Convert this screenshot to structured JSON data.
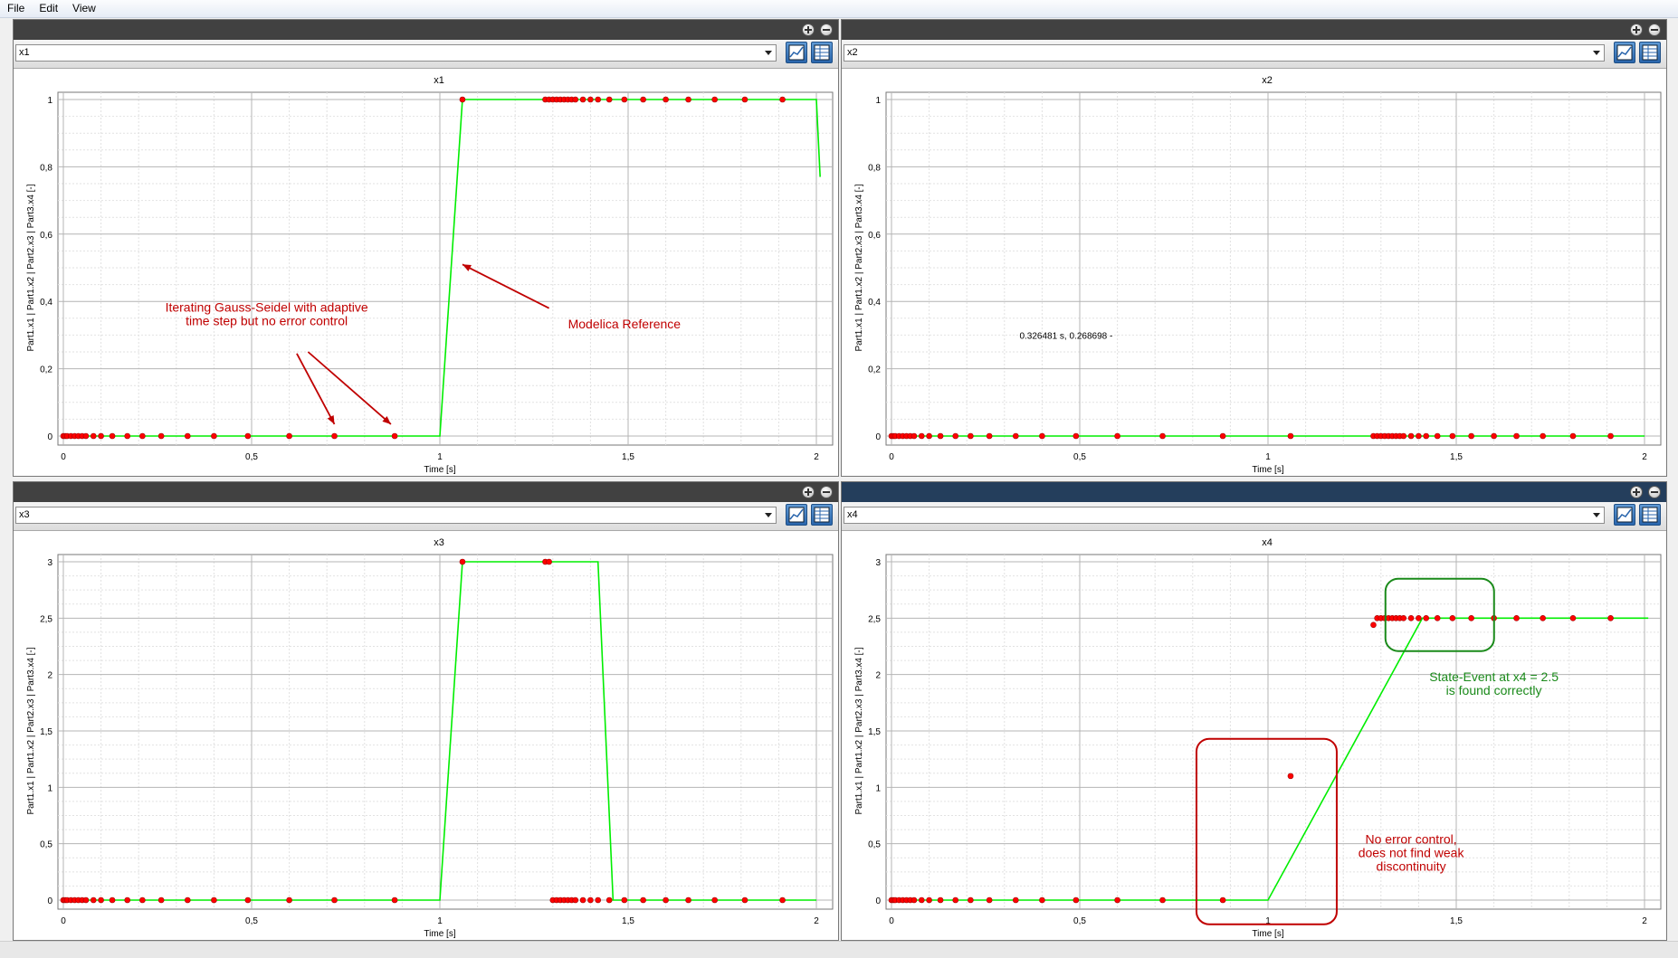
{
  "menu": [
    "File",
    "Edit",
    "View"
  ],
  "panels": [
    {
      "selector_value": "x1",
      "title": "x1",
      "ylabel": "Part1.x1 | Part1.x2 | Part2.x3 | Part3.x4 [-]",
      "xlabel": "Time [s]",
      "xticks": [
        "0",
        "0,5",
        "1",
        "1,5",
        "2"
      ],
      "yticks": [
        "0",
        "0,2",
        "0,4",
        "0,6",
        "0,8",
        "1"
      ],
      "annotations": [
        {
          "lines": [
            "Iterating Gauss-Seidel with adaptive",
            "time step but no error control"
          ],
          "color": "#c00000"
        },
        {
          "lines": [
            "Modelica Reference"
          ],
          "color": "#c00000"
        }
      ]
    },
    {
      "selector_value": "x2",
      "title": "x2",
      "ylabel": "Part1.x1 | Part1.x2 | Part2.x3 | Part3.x4 [-]",
      "xlabel": "Time [s]",
      "xticks": [
        "0",
        "0,5",
        "1",
        "1,5",
        "2"
      ],
      "yticks": [
        "0",
        "0,2",
        "0,4",
        "0,6",
        "0,8",
        "1"
      ],
      "cursor_readout": "0.326481 s, 0.268698 -"
    },
    {
      "selector_value": "x3",
      "title": "x3",
      "ylabel": "Part1.x1 | Part1.x2 | Part2.x3 | Part3.x4 [-]",
      "xlabel": "Time [s]",
      "xticks": [
        "0",
        "0,5",
        "1",
        "1,5",
        "2"
      ],
      "yticks": [
        "0",
        "0,5",
        "1",
        "1,5",
        "2",
        "2,5",
        "3"
      ]
    },
    {
      "selector_value": "x4",
      "title": "x4",
      "ylabel": "Part1.x1 | Part1.x2 | Part2.x3 | Part3.x4 [-]",
      "xlabel": "Time [s]",
      "xticks": [
        "0",
        "0,5",
        "1",
        "1,5",
        "2"
      ],
      "yticks": [
        "0",
        "0,5",
        "1",
        "1,5",
        "2",
        "2,5",
        "3"
      ],
      "annotations": [
        {
          "lines": [
            "State-Event at x4 = 2.5",
            "is found correctly"
          ],
          "color": "#1a8a1a"
        },
        {
          "lines": [
            "No error control,",
            "does not find weak",
            "discontinuity"
          ],
          "color": "#c00000"
        }
      ]
    }
  ],
  "colors": {
    "reference_line": "#00ee00",
    "samples": "#ff0000",
    "grid_major": "#b4b4b4",
    "grid_minor": "#e2e2e2"
  },
  "chart_data": [
    {
      "type": "line",
      "title": "x1",
      "xlabel": "Time [s]",
      "ylabel": "Part1.x1 | Part1.x2 | Part2.x3 | Part3.x4 [-]",
      "xlim": [
        0,
        2
      ],
      "ylim": [
        0,
        1
      ],
      "grid": true,
      "series": [
        {
          "x": [
            0,
            1.0,
            1.06,
            1.3,
            2.0,
            2.01
          ],
          "y": [
            0,
            0,
            1,
            1,
            1,
            0.77
          ]
        },
        {
          "x": [
            0.0,
            0.005,
            0.01,
            0.02,
            0.03,
            0.04,
            0.05,
            0.06,
            0.08,
            0.1,
            0.13,
            0.17,
            0.21,
            0.26,
            0.33,
            0.4,
            0.49,
            0.6,
            0.72,
            0.88,
            1.06,
            1.28,
            1.29,
            1.3,
            1.31,
            1.32,
            1.33,
            1.34,
            1.35,
            1.36,
            1.38,
            1.4,
            1.42,
            1.45,
            1.49,
            1.54,
            1.6,
            1.66,
            1.73,
            1.81,
            1.91
          ],
          "y": [
            0,
            0,
            0,
            0,
            0,
            0,
            0,
            0,
            0,
            0,
            0,
            0,
            0,
            0,
            0,
            0,
            0,
            0,
            0,
            0,
            1,
            1,
            1,
            1,
            1,
            1,
            1,
            1,
            1,
            1,
            1,
            1,
            1,
            1,
            1,
            1,
            1,
            1,
            1,
            1,
            1
          ]
        }
      ]
    },
    {
      "type": "line",
      "title": "x2",
      "xlabel": "Time [s]",
      "ylabel": "Part1.x1 | Part1.x2 | Part2.x3 | Part3.x4 [-]",
      "xlim": [
        0,
        2
      ],
      "ylim": [
        0,
        1
      ],
      "grid": true,
      "series": [
        {
          "x": [
            0,
            2.0
          ],
          "y": [
            0,
            0
          ]
        },
        {
          "x": [
            0.0,
            0.005,
            0.01,
            0.02,
            0.03,
            0.04,
            0.05,
            0.06,
            0.08,
            0.1,
            0.13,
            0.17,
            0.21,
            0.26,
            0.33,
            0.4,
            0.49,
            0.6,
            0.72,
            0.88,
            1.06,
            1.28,
            1.29,
            1.3,
            1.31,
            1.32,
            1.33,
            1.34,
            1.35,
            1.36,
            1.38,
            1.4,
            1.42,
            1.45,
            1.49,
            1.54,
            1.6,
            1.66,
            1.73,
            1.81,
            1.91
          ],
          "y": [
            0,
            0,
            0,
            0,
            0,
            0,
            0,
            0,
            0,
            0,
            0,
            0,
            0,
            0,
            0,
            0,
            0,
            0,
            0,
            0,
            0,
            0,
            0,
            0,
            0,
            0,
            0,
            0,
            0,
            0,
            0,
            0,
            0,
            0,
            0,
            0,
            0,
            0,
            0,
            0,
            0
          ]
        }
      ]
    },
    {
      "type": "line",
      "title": "x3",
      "xlabel": "Time [s]",
      "ylabel": "Part1.x1 | Part1.x2 | Part2.x3 | Part3.x4 [-]",
      "xlim": [
        0,
        2
      ],
      "ylim": [
        0,
        3
      ],
      "grid": true,
      "series": [
        {
          "x": [
            0,
            1.0,
            1.06,
            1.42,
            1.46,
            2.0
          ],
          "y": [
            0,
            0,
            3,
            3,
            0,
            0
          ]
        },
        {
          "x": [
            0.0,
            0.005,
            0.01,
            0.02,
            0.03,
            0.04,
            0.05,
            0.06,
            0.08,
            0.1,
            0.13,
            0.17,
            0.21,
            0.26,
            0.33,
            0.4,
            0.49,
            0.6,
            0.72,
            0.88,
            1.06,
            1.28,
            1.29,
            1.3,
            1.31,
            1.32,
            1.33,
            1.34,
            1.35,
            1.36,
            1.38,
            1.4,
            1.42,
            1.45,
            1.49,
            1.54,
            1.6,
            1.66,
            1.73,
            1.81,
            1.91
          ],
          "y": [
            0,
            0,
            0,
            0,
            0,
            0,
            0,
            0,
            0,
            0,
            0,
            0,
            0,
            0,
            0,
            0,
            0,
            0,
            0,
            0,
            3,
            3,
            3,
            0,
            0,
            0,
            0,
            0,
            0,
            0,
            0,
            0,
            0,
            0,
            0,
            0,
            0,
            0,
            0,
            0,
            0
          ]
        }
      ]
    },
    {
      "type": "line",
      "title": "x4",
      "xlabel": "Time [s]",
      "ylabel": "Part1.x1 | Part1.x2 | Part2.x3 | Part3.x4 [-]",
      "xlim": [
        0,
        2
      ],
      "ylim": [
        0,
        3
      ],
      "grid": true,
      "series": [
        {
          "x": [
            0,
            1.0,
            1.41,
            2.01
          ],
          "y": [
            0,
            0,
            2.5,
            2.5
          ]
        },
        {
          "x": [
            0.0,
            0.005,
            0.01,
            0.02,
            0.03,
            0.04,
            0.05,
            0.06,
            0.08,
            0.1,
            0.13,
            0.17,
            0.21,
            0.26,
            0.33,
            0.4,
            0.49,
            0.6,
            0.72,
            0.88,
            1.06,
            1.28,
            1.29,
            1.3,
            1.31,
            1.32,
            1.33,
            1.34,
            1.35,
            1.36,
            1.38,
            1.4,
            1.42,
            1.45,
            1.49,
            1.54,
            1.6,
            1.66,
            1.73,
            1.81,
            1.91
          ],
          "y": [
            0,
            0,
            0,
            0,
            0,
            0,
            0,
            0,
            0,
            0,
            0,
            0,
            0,
            0,
            0,
            0,
            0,
            0,
            0,
            0,
            1.1,
            2.44,
            2.5,
            2.5,
            2.5,
            2.5,
            2.5,
            2.5,
            2.5,
            2.5,
            2.5,
            2.5,
            2.5,
            2.5,
            2.5,
            2.5,
            2.5,
            2.5,
            2.5,
            2.5,
            2.5
          ]
        }
      ]
    }
  ]
}
